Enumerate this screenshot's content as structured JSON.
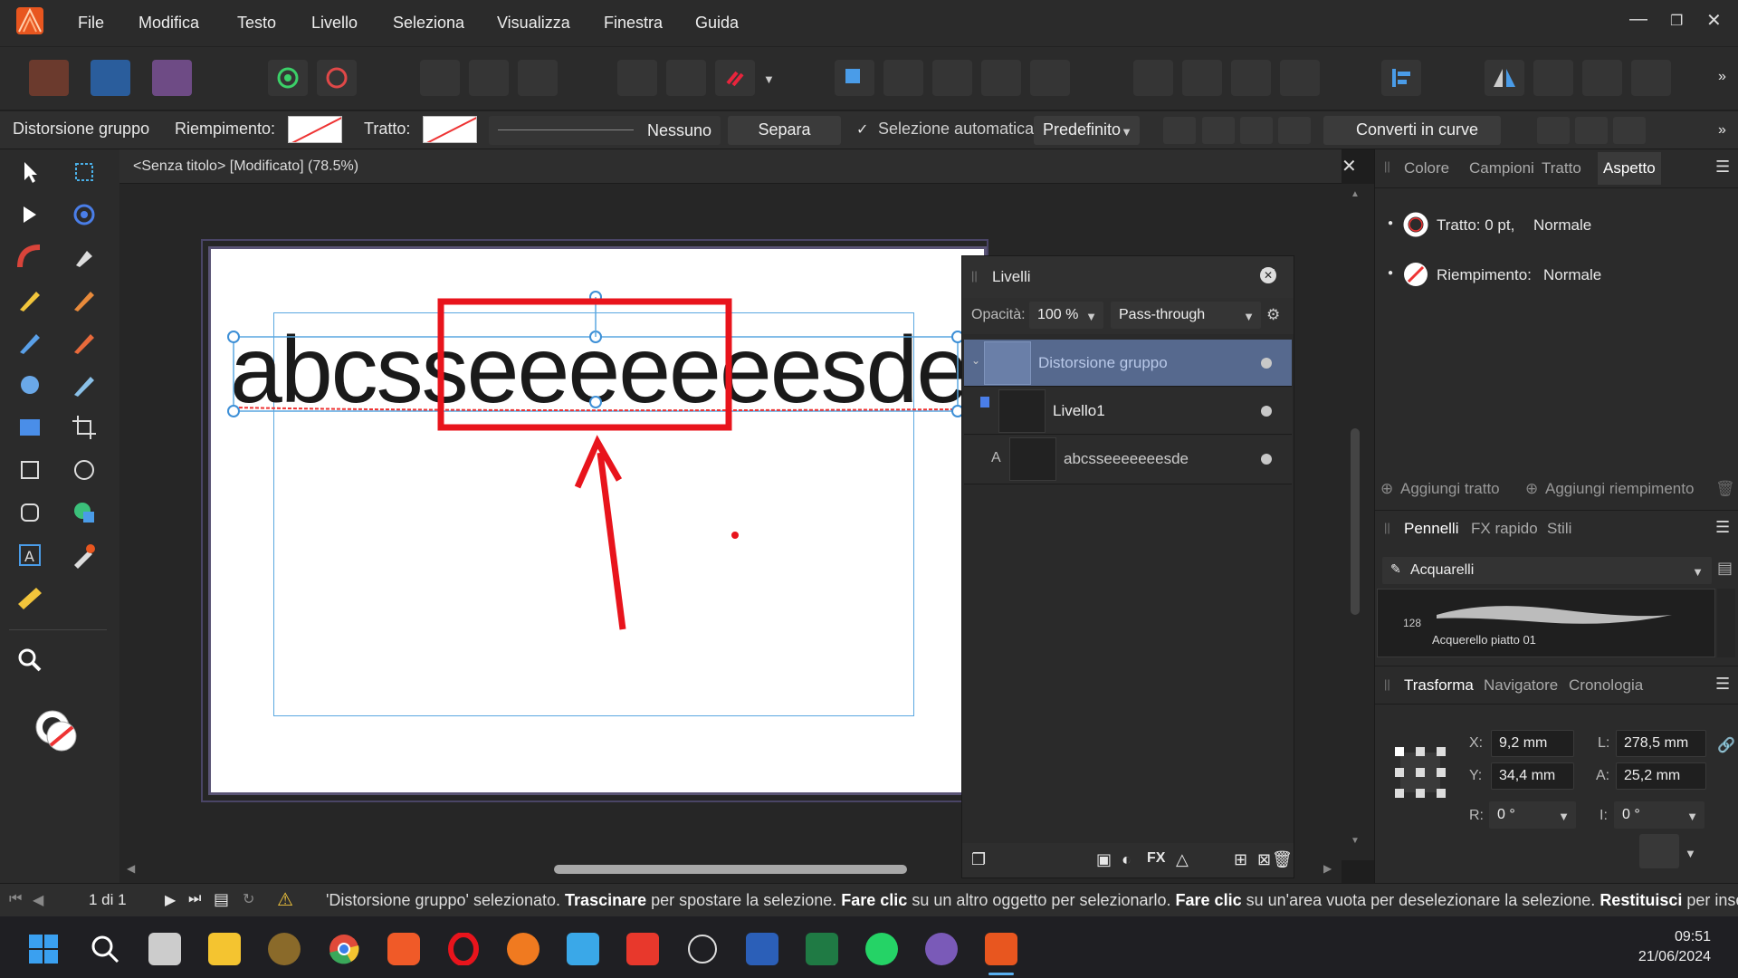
{
  "menu": {
    "items": [
      "File",
      "Modifica",
      "Testo",
      "Livello",
      "Seleziona",
      "Visualizza",
      "Finestra",
      "Guida"
    ]
  },
  "context": {
    "tool_name": "Distorsione gruppo",
    "fill_label": "Riempimento:",
    "stroke_label": "Tratto:",
    "stroke_style": "Nessuno",
    "separate_label": "Separa",
    "auto_select_label": "Selezione automatica:",
    "auto_select_value": "Predefinito",
    "convert_label": "Converti in curve"
  },
  "document": {
    "tab_title": "<Senza titolo> [Modificato] (78.5%)",
    "text_content": "abcsseeeeeeesde"
  },
  "layers": {
    "title": "Livelli",
    "opacity_label": "Opacità:",
    "opacity_value": "100 %",
    "blend_mode": "Pass-through",
    "rows": [
      {
        "name": "Distorsione gruppo"
      },
      {
        "name": "Livello1"
      },
      {
        "name": "abcsseeeeeeesde",
        "type_letter": "A"
      }
    ]
  },
  "appearance": {
    "tabs": [
      "Colore",
      "Campioni",
      "Tratto",
      "Aspetto"
    ],
    "stroke_line": "Tratto: 0 pt,",
    "stroke_mode": "Normale",
    "fill_line": "Riempimento:",
    "fill_mode": "Normale",
    "add_stroke": "Aggiungi tratto",
    "add_fill": "Aggiungi riempimento"
  },
  "brushes": {
    "tabs": [
      "Pennelli",
      "FX rapido",
      "Stili"
    ],
    "category": "Acquarelli",
    "brush_size": "128",
    "brush_name": "Acquerello piatto 01"
  },
  "transform": {
    "tabs": [
      "Trasforma",
      "Navigatore",
      "Cronologia"
    ],
    "x_label": "X:",
    "x_value": "9,2 mm",
    "y_label": "Y:",
    "y_value": "34,4 mm",
    "w_label": "L:",
    "w_value": "278,5 mm",
    "h_label": "A:",
    "h_value": "25,2 mm",
    "r_label": "R:",
    "r_value": "0 °",
    "s_label": "I:",
    "s_value": "0 °"
  },
  "status": {
    "page_indicator": "1 di 1",
    "msg_1": "'Distorsione gruppo' selezionato.",
    "msg_b1": "Trascinare",
    "msg_2": "per spostare la selezione.",
    "msg_b2": "Fare clic",
    "msg_3": "su un altro oggetto per selezionarlo.",
    "msg_b3": "Fare clic",
    "msg_4": "su un'area vuota per deselezionare la selezione.",
    "msg_b4": "Restituisci",
    "msg_5": "per inserire"
  },
  "taskbar": {
    "time": "09:51",
    "date": "21/06/2024"
  },
  "colors": {
    "accent": "#56698e",
    "annotation_red": "#e8141c",
    "bg": "#2b2b2b"
  }
}
